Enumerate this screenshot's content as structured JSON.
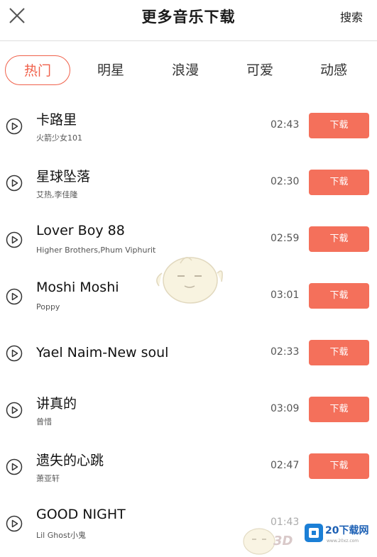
{
  "header": {
    "title": "更多音乐下载",
    "search_label": "搜索",
    "close_icon": "close-icon"
  },
  "tabs": [
    {
      "label": "热门",
      "active": true
    },
    {
      "label": "明星",
      "active": false
    },
    {
      "label": "浪漫",
      "active": false
    },
    {
      "label": "可爱",
      "active": false
    },
    {
      "label": "动感",
      "active": false
    }
  ],
  "songs": [
    {
      "title": "卡路里",
      "artist": "火箭少女101",
      "duration": "02:43",
      "download_label": "下载"
    },
    {
      "title": "星球坠落",
      "artist": "艾热,李佳隆",
      "duration": "02:30",
      "download_label": "下载"
    },
    {
      "title": "Lover Boy 88",
      "artist": "Higher Brothers,Phum Viphurit",
      "duration": "02:59",
      "download_label": "下载"
    },
    {
      "title": "Moshi Moshi",
      "artist": "Poppy",
      "duration": "03:01",
      "download_label": "下载"
    },
    {
      "title": "Yael Naim-New soul",
      "artist": "",
      "duration": "02:33",
      "download_label": "下载"
    },
    {
      "title": "讲真的",
      "artist": "曾惜",
      "duration": "03:09",
      "download_label": "下载"
    },
    {
      "title": "遗失的心跳",
      "artist": "萧亚轩",
      "duration": "02:47",
      "download_label": "下载"
    },
    {
      "title": "GOOD NIGHT",
      "artist": "Lil Ghost小鬼",
      "duration": "01:43",
      "download_label": ""
    }
  ],
  "watermark": {
    "logo_text": "20下载网",
    "url": "www.20xz.com",
    "brand_3d": "3D"
  },
  "colors": {
    "accent": "#f0614b",
    "button": "#f4705b"
  }
}
